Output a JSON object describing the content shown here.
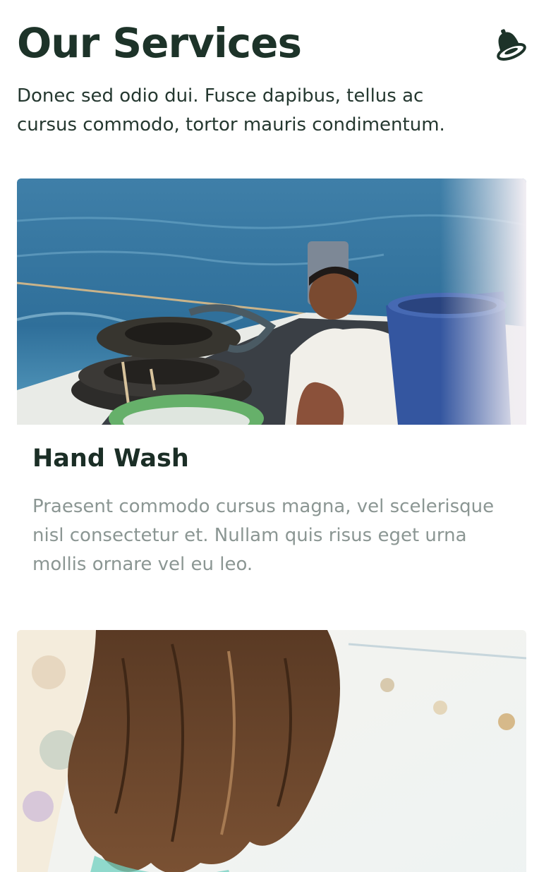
{
  "header": {
    "title": "Our Services",
    "notification_icon": "bell-icon"
  },
  "intro": {
    "text": "Donec sed odio dui. Fusce dapibus, tellus ac cursus commodo, tortor mauris condimentum."
  },
  "services": [
    {
      "title": "Hand Wash",
      "description": "Praesent commodo cursus magna, vel scelerisque nisl consectetur et. Nullam quis risus eget urna mollis ornare vel eu leo.",
      "image": "photo-man-washing-dishes-on-boat"
    },
    {
      "image": "photo-woman-long-hair"
    }
  ],
  "colors": {
    "heading": "#1d3329",
    "body_text": "#253830",
    "muted_text": "#8b9693",
    "background": "#ffffff"
  }
}
